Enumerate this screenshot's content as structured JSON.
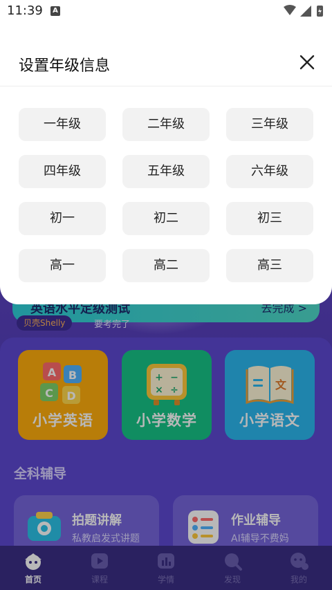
{
  "status_bar": {
    "time": "11:39",
    "notification_letter": "A"
  },
  "dialog": {
    "title": "设置年级信息",
    "grades": [
      "一年级",
      "二年级",
      "三年级",
      "四年级",
      "五年级",
      "六年级",
      "初一",
      "初二",
      "初三",
      "高一",
      "高二",
      "高三"
    ]
  },
  "banner": {
    "title": "英语水平定级测试",
    "action": "去完成 >",
    "tag": "贝壳Shelly",
    "tag_text": "要考完了"
  },
  "subjects": [
    "小学英语",
    "小学数学",
    "小学语文"
  ],
  "section": {
    "title": "全科辅导"
  },
  "features": [
    {
      "title": "拍题讲解",
      "subtitle": "私教启发式讲题"
    },
    {
      "title": "作业辅导",
      "subtitle": "AI辅导不费妈"
    }
  ],
  "tabs": [
    "首页",
    "课程",
    "学情",
    "发现",
    "我的"
  ],
  "colors": {
    "accent": "#5e49d2",
    "english": "#ffad0d",
    "math": "#17c487",
    "chinese": "#2bb7ef"
  }
}
